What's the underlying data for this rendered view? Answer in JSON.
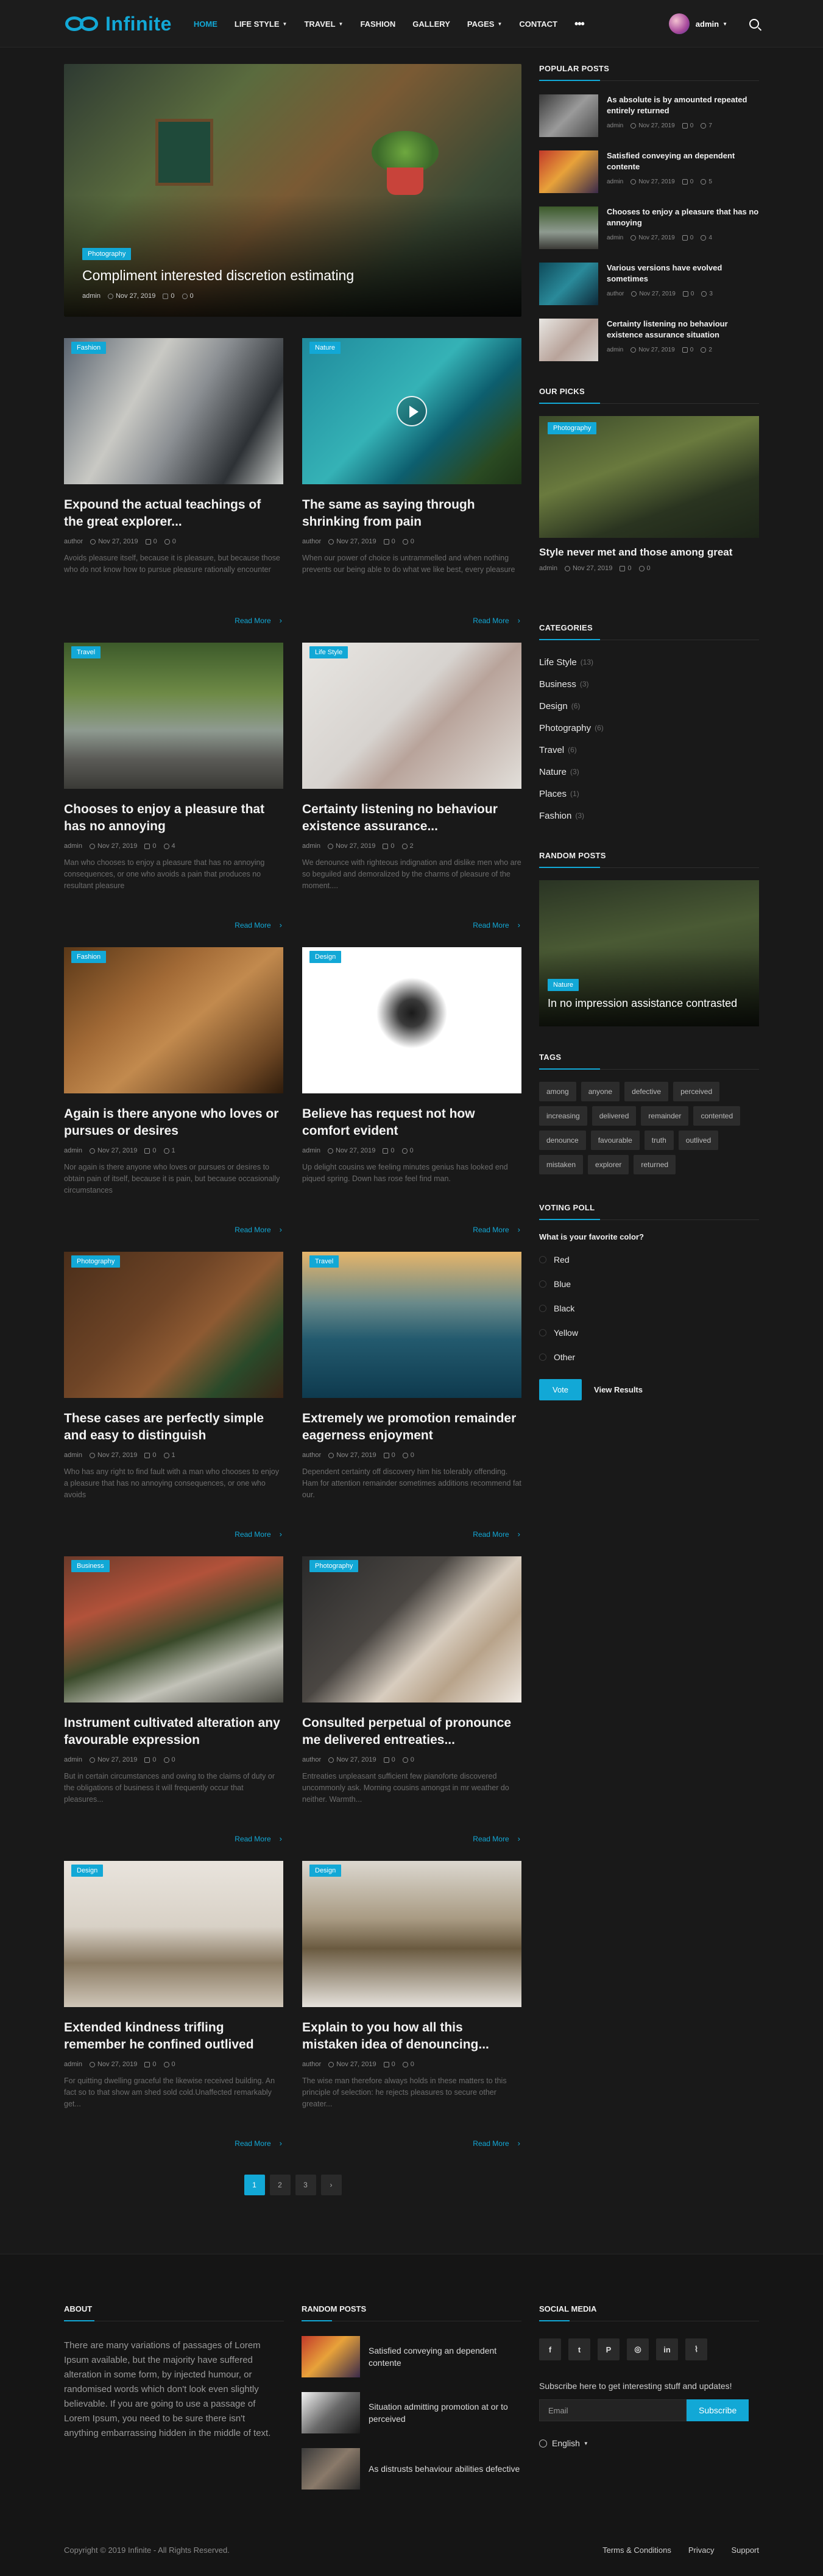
{
  "header": {
    "logo_text": "Infinite",
    "nav": [
      {
        "label": "HOME",
        "active": true,
        "caret": false
      },
      {
        "label": "LIFE STYLE",
        "active": false,
        "caret": true
      },
      {
        "label": "TRAVEL",
        "active": false,
        "caret": true
      },
      {
        "label": "FASHION",
        "active": false,
        "caret": false
      },
      {
        "label": "GALLERY",
        "active": false,
        "caret": false
      },
      {
        "label": "PAGES",
        "active": false,
        "caret": true
      },
      {
        "label": "CONTACT",
        "active": false,
        "caret": false
      }
    ],
    "more_label": "•••",
    "user_name": "admin"
  },
  "featured": {
    "category": "Photography",
    "title": "Compliment interested discretion estimating",
    "author": "admin",
    "date": "Nov 27, 2019",
    "comments": "0",
    "views": "0"
  },
  "posts": [
    {
      "category": "Fashion",
      "title": "Expound the actual teachings of the great explorer...",
      "author": "author",
      "date": "Nov 27, 2019",
      "comments": "0",
      "views": "0",
      "excerpt": "Avoids pleasure itself, because it is pleasure, but because those who do not know how to pursue pleasure rationally encounter",
      "read_more": "Read More",
      "video": false
    },
    {
      "category": "Nature",
      "title": "The same as saying through shrinking from pain",
      "author": "author",
      "date": "Nov 27, 2019",
      "comments": "0",
      "views": "0",
      "excerpt": "When our power of choice is untrammelled and when nothing prevents our being able to do what we like best, every pleasure",
      "read_more": "Read More",
      "video": true
    },
    {
      "category": "Travel",
      "title": "Chooses to enjoy a pleasure that has no annoying",
      "author": "admin",
      "date": "Nov 27, 2019",
      "comments": "0",
      "views": "4",
      "excerpt": "Man who chooses to enjoy a pleasure that has no annoying consequences, or one who avoids a pain that produces no resultant pleasure",
      "read_more": "Read More",
      "video": false
    },
    {
      "category": "Life Style",
      "title": "Certainty listening no behaviour existence assurance...",
      "author": "admin",
      "date": "Nov 27, 2019",
      "comments": "0",
      "views": "2",
      "excerpt": "We denounce with righteous indignation and dislike men who are so beguiled and demoralized by the charms of pleasure of the moment....",
      "read_more": "Read More",
      "video": false
    },
    {
      "category": "Fashion",
      "title": "Again is there anyone who loves or pursues or desires",
      "author": "admin",
      "date": "Nov 27, 2019",
      "comments": "0",
      "views": "1",
      "excerpt": "Nor again is there anyone who loves or pursues or desires to obtain pain of itself, because it is pain, but because occasionally circumstances",
      "read_more": "Read More",
      "video": false
    },
    {
      "category": "Design",
      "title": "Believe has request not how comfort evident",
      "author": "admin",
      "date": "Nov 27, 2019",
      "comments": "0",
      "views": "0",
      "excerpt": "Up delight cousins we feeling minutes genius has looked end piqued spring. Down has rose feel find man.",
      "read_more": "Read More",
      "video": false
    },
    {
      "category": "Photography",
      "title": "These cases are perfectly simple and easy to distinguish",
      "author": "admin",
      "date": "Nov 27, 2019",
      "comments": "0",
      "views": "1",
      "excerpt": "Who has any right to find fault with a man who chooses to enjoy a pleasure that has no annoying consequences, or one who avoids",
      "read_more": "Read More",
      "video": false
    },
    {
      "category": "Travel",
      "title": "Extremely we promotion remainder eagerness enjoyment",
      "author": "author",
      "date": "Nov 27, 2019",
      "comments": "0",
      "views": "0",
      "excerpt": "Dependent certainty off discovery him his tolerably offending. Ham for attention remainder sometimes additions recommend fat our.",
      "read_more": "Read More",
      "video": false
    },
    {
      "category": "Business",
      "title": "Instrument cultivated alteration any favourable expression",
      "author": "admin",
      "date": "Nov 27, 2019",
      "comments": "0",
      "views": "0",
      "excerpt": "But in certain circumstances and owing to the claims of duty or the obligations of business it will frequently occur that pleasures...",
      "read_more": "Read More",
      "video": false
    },
    {
      "category": "Photography",
      "title": "Consulted perpetual of pronounce me delivered entreaties...",
      "author": "author",
      "date": "Nov 27, 2019",
      "comments": "0",
      "views": "0",
      "excerpt": "Entreaties unpleasant sufficient few pianoforte discovered uncommonly ask. Morning cousins amongst in mr weather do neither. Warmth...",
      "read_more": "Read More",
      "video": false
    },
    {
      "category": "Design",
      "title": "Extended kindness trifling remember he confined outlived",
      "author": "admin",
      "date": "Nov 27, 2019",
      "comments": "0",
      "views": "0",
      "excerpt": "For quitting dwelling graceful the likewise received building. An fact so to that show am shed sold cold.Unaffected remarkably get...",
      "read_more": "Read More",
      "video": false
    },
    {
      "category": "Design",
      "title": "Explain to you how all this mistaken idea of denouncing...",
      "author": "author",
      "date": "Nov 27, 2019",
      "comments": "0",
      "views": "0",
      "excerpt": "The wise man therefore always holds in these matters to this principle of selection: he rejects pleasures to secure other greater...",
      "read_more": "Read More",
      "video": false
    }
  ],
  "pagination": {
    "pages": [
      "1",
      "2",
      "3"
    ],
    "next": "›",
    "active": "1"
  },
  "sidebar": {
    "popular": {
      "title": "POPULAR POSTS",
      "items": [
        {
          "title": "As absolute is by amounted repeated entirely returned",
          "author": "admin",
          "date": "Nov 27, 2019",
          "comments": "0",
          "views": "7"
        },
        {
          "title": "Satisfied conveying an dependent contente",
          "author": "admin",
          "date": "Nov 27, 2019",
          "comments": "0",
          "views": "5"
        },
        {
          "title": "Chooses to enjoy a pleasure that has no annoying",
          "author": "admin",
          "date": "Nov 27, 2019",
          "comments": "0",
          "views": "4"
        },
        {
          "title": "Various versions have evolved sometimes",
          "author": "author",
          "date": "Nov 27, 2019",
          "comments": "0",
          "views": "3"
        },
        {
          "title": "Certainty listening no behaviour existence assurance situation",
          "author": "admin",
          "date": "Nov 27, 2019",
          "comments": "0",
          "views": "2"
        }
      ]
    },
    "picks": {
      "title": "OUR PICKS",
      "category": "Photography",
      "post_title": "Style never met and those among great",
      "author": "admin",
      "date": "Nov 27, 2019",
      "comments": "0",
      "views": "0"
    },
    "categories": {
      "title": "CATEGORIES",
      "items": [
        {
          "name": "Life Style",
          "count": "(13)"
        },
        {
          "name": "Business",
          "count": "(3)"
        },
        {
          "name": "Design",
          "count": "(6)"
        },
        {
          "name": "Photography",
          "count": "(6)"
        },
        {
          "name": "Travel",
          "count": "(6)"
        },
        {
          "name": "Nature",
          "count": "(3)"
        },
        {
          "name": "Places",
          "count": "(1)"
        },
        {
          "name": "Fashion",
          "count": "(3)"
        }
      ]
    },
    "random": {
      "title": "RANDOM POSTS",
      "category": "Nature",
      "post_title": "In no impression assistance contrasted"
    },
    "tags": {
      "title": "TAGS",
      "items": [
        "among",
        "anyone",
        "defective",
        "perceived",
        "increasing",
        "delivered",
        "remainder",
        "contented",
        "denounce",
        "favourable",
        "truth",
        "outlived",
        "mistaken",
        "explorer",
        "returned"
      ]
    },
    "poll": {
      "title": "VOTING POLL",
      "question": "What is your favorite color?",
      "options": [
        "Red",
        "Blue",
        "Black",
        "Yellow",
        "Other"
      ],
      "vote_label": "Vote",
      "results_label": "View Results"
    }
  },
  "footer": {
    "about": {
      "title": "ABOUT",
      "text": "There are many variations of passages of Lorem Ipsum available, but the majority have suffered alteration in some form, by injected humour, or randomised words which don't look even slightly believable. If you are going to use a passage of Lorem Ipsum, you need to be sure there isn't anything embarrassing hidden in the middle of text."
    },
    "random": {
      "title": "RANDOM POSTS",
      "items": [
        {
          "title": "Satisfied conveying an dependent contente"
        },
        {
          "title": "Situation admitting promotion at or to perceived"
        },
        {
          "title": "As distrusts behaviour abilities defective"
        }
      ]
    },
    "social": {
      "title": "SOCIAL MEDIA",
      "icons": [
        {
          "name": "facebook-icon",
          "glyph": "f"
        },
        {
          "name": "twitter-icon",
          "glyph": "t"
        },
        {
          "name": "pinterest-icon",
          "glyph": "P"
        },
        {
          "name": "instagram-icon",
          "glyph": "◎"
        },
        {
          "name": "linkedin-icon",
          "glyph": "in"
        },
        {
          "name": "rss-icon",
          "glyph": "⌇"
        }
      ],
      "subscribe_text": "Subscribe here to get interesting stuff and updates!",
      "email_placeholder": "Email",
      "subscribe_label": "Subscribe",
      "language": "English"
    },
    "copyright": "Copyright © 2019 Infinite - All Rights Reserved.",
    "links": [
      "Terms & Conditions",
      "Privacy",
      "Support"
    ]
  },
  "colors": {
    "accent": "#12a8d6",
    "background": "#191919"
  }
}
